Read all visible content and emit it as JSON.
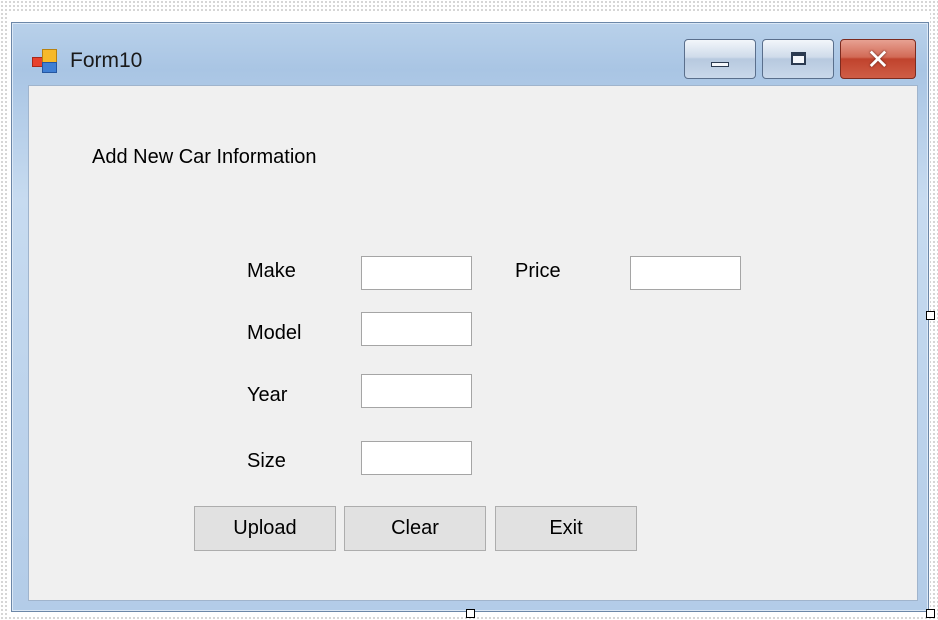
{
  "window": {
    "title": "Form10"
  },
  "form": {
    "heading": "Add New Car Information",
    "fields": {
      "make": {
        "label": "Make",
        "value": ""
      },
      "price": {
        "label": "Price",
        "value": ""
      },
      "model": {
        "label": "Model",
        "value": ""
      },
      "year": {
        "label": "Year",
        "value": ""
      },
      "size": {
        "label": "Size",
        "value": ""
      }
    },
    "buttons": {
      "upload": "Upload",
      "clear": "Clear",
      "exit": "Exit"
    }
  },
  "icons": {
    "app": "windows-form-icon",
    "minimize": "minimize-icon",
    "maximize": "maximize-icon",
    "close": "close-icon"
  },
  "colors": {
    "frame": "#b9d1ea",
    "client": "#f0f0f0",
    "close_button": "#c7432d",
    "button_face": "#e1e1e1"
  }
}
